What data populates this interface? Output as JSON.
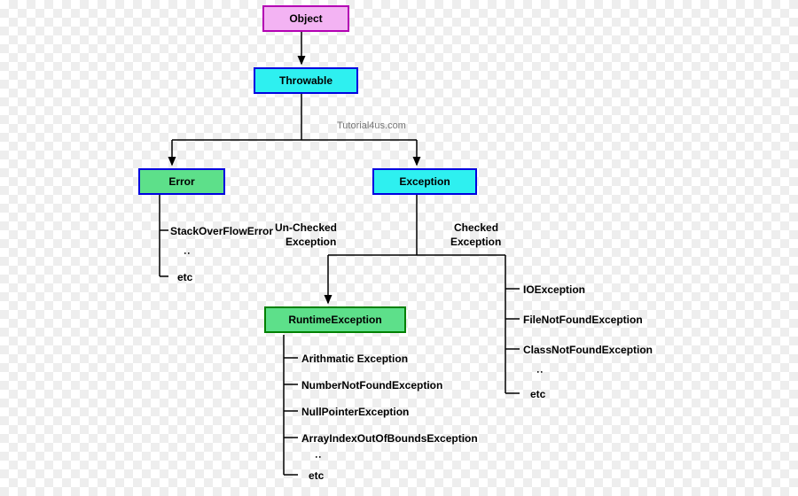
{
  "watermark": "Tutorial4us.com",
  "nodes": {
    "object": "Object",
    "throwable": "Throwable",
    "error": "Error",
    "exception": "Exception",
    "runtime": "RuntimeException"
  },
  "labels": {
    "unchecked_l1": "Un-Checked",
    "unchecked_l2": "Exception",
    "checked_l1": "Checked",
    "checked_l2": "Exception"
  },
  "error_children": {
    "i0": "StackOverFlowError",
    "etc": "etc"
  },
  "checked_children": {
    "i0": "IOException",
    "i1": "FileNotFoundException",
    "i2": "ClassNotFoundException",
    "etc": "etc"
  },
  "runtime_children": {
    "i0": "Arithmatic Exception",
    "i1": "NumberNotFoundException",
    "i2": "NullPointerException",
    "i3": "ArrayIndexOutOfBoundsException",
    "etc": "etc"
  },
  "dots": ":"
}
